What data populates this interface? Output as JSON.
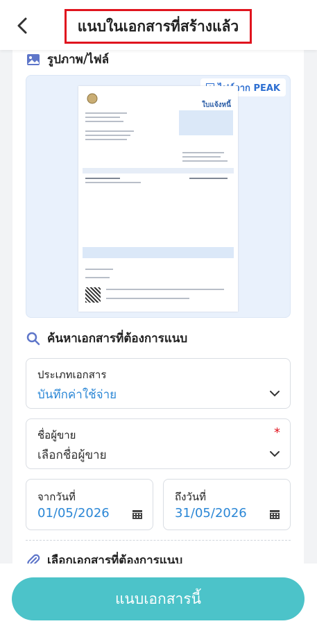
{
  "header": {
    "title": "แนบในเอกสารที่สร้างแล้ว"
  },
  "image_section": {
    "label": "รูปภาพ/ไฟล์",
    "badge": "ไฟล์จาก PEAK",
    "doc_title": "ใบแจ้งหนี้"
  },
  "search_section": {
    "label": "ค้นหาเอกสารที่ต้องการแนบ"
  },
  "doc_type": {
    "label": "ประเภทเอกสาร",
    "value": "บันทึกค่าใช้จ่าย"
  },
  "vendor": {
    "label": "ชื่อผู้ขาย",
    "placeholder": "เลือกชื่อผู้ขาย",
    "required_mark": "*"
  },
  "from_date": {
    "label": "จากวันที่",
    "value": "01/05/2026"
  },
  "to_date": {
    "label": "ถึงวันที่",
    "value": "31/05/2026"
  },
  "select_section": {
    "label": "เลือกเอกสารที่ต้องการแนบ"
  },
  "footer": {
    "attach_label": "แนบเอกสารนี้"
  },
  "colors": {
    "accent": "#4cc3c9",
    "link": "#2b87d6",
    "highlight": "#e0141e"
  }
}
